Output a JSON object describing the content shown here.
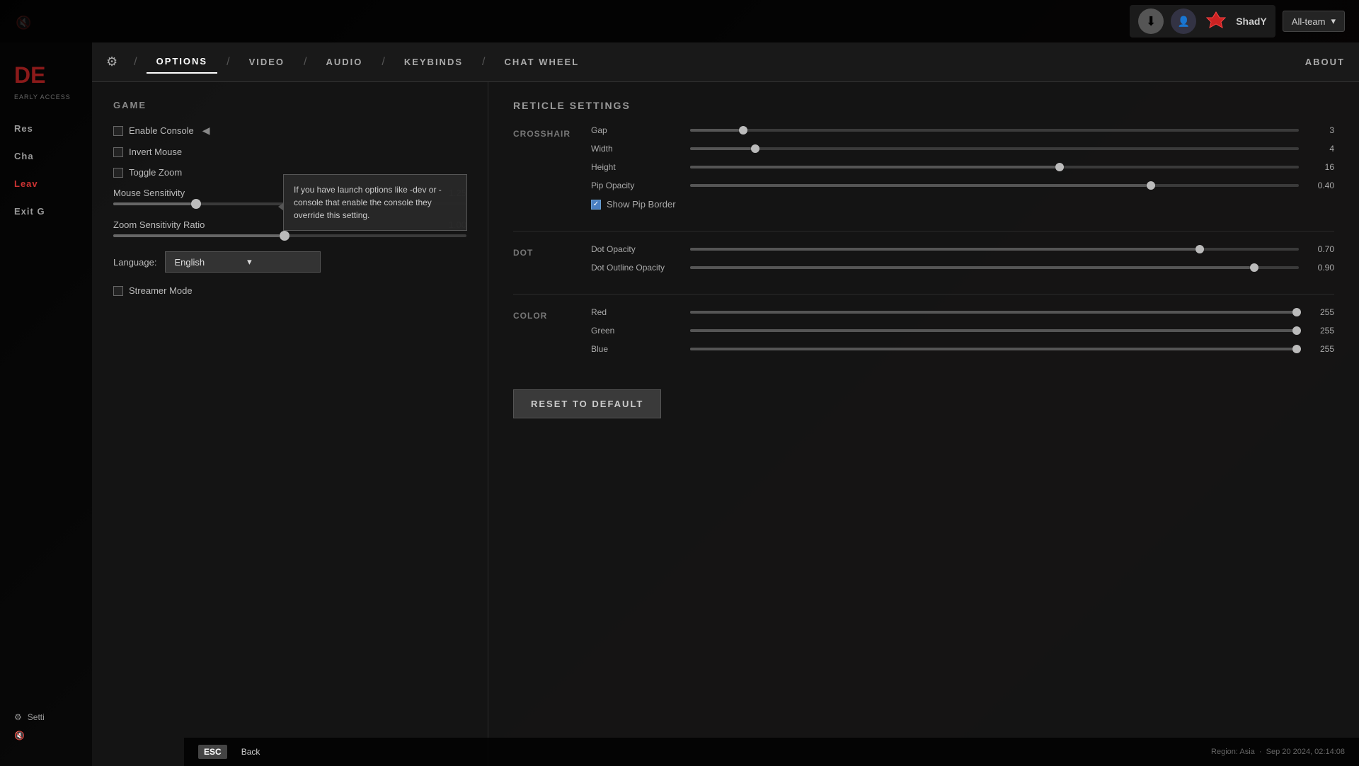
{
  "app": {
    "volume_icon": "🔇"
  },
  "topbar": {
    "download_icon": "⬇",
    "user_avatar_icon": "👤",
    "user_badge_color": "#cc2222",
    "username": "ShadY",
    "team_selector_label": "All-team",
    "chevron_down": "▾"
  },
  "sidebar": {
    "logo_text": "DE",
    "subtitle": "EARLY ACCESS",
    "items": [
      {
        "label": "Res",
        "active": false,
        "red": false
      },
      {
        "label": "Cha",
        "active": false,
        "red": false
      },
      {
        "label": "Leav",
        "active": false,
        "red": true
      },
      {
        "label": "Exit G",
        "active": false,
        "red": false
      }
    ],
    "settings_label": "Setti",
    "settings_icon": "⚙",
    "volume_icon": "🔇"
  },
  "navbar": {
    "gear_icon": "⚙",
    "options_label": "OPTIONS",
    "video_label": "VIDEO",
    "audio_label": "AUDIO",
    "keybinds_label": "KEYBINDS",
    "chat_wheel_label": "CHAT WHEEL",
    "about_label": "ABOUT",
    "sep": "/"
  },
  "game_section": {
    "title": "GAME",
    "enable_console": {
      "label": "Enable Console",
      "checked": false
    },
    "invert_mouse": {
      "label": "Invert Mouse",
      "checked": false
    },
    "toggle_zoom": {
      "label": "Toggle Zoom",
      "checked": false
    },
    "tooltip": "If you have launch options like -dev or -console that enable the console they override this setting.",
    "mouse_sensitivity": {
      "label": "Mouse Sensitivity",
      "value": "1.25",
      "percent": 22
    },
    "zoom_sensitivity": {
      "label": "Zoom Sensitivity Ratio",
      "value": "1.00",
      "percent": 47
    },
    "language": {
      "label": "Language:",
      "value": "English"
    },
    "streamer_mode": {
      "label": "Streamer Mode",
      "checked": false
    }
  },
  "reticle_section": {
    "title": "RETICLE SETTINGS",
    "crosshair": {
      "label": "CROSSHAIR",
      "gap": {
        "label": "Gap",
        "value": "3",
        "percent": 8
      },
      "width": {
        "label": "Width",
        "value": "4",
        "percent": 10
      },
      "height": {
        "label": "Height",
        "value": "16",
        "percent": 60
      },
      "pip_opacity": {
        "label": "Pip Opacity",
        "value": "0.40",
        "percent": 75
      },
      "show_pip_border": {
        "label": "Show Pip Border",
        "checked": true
      }
    },
    "dot": {
      "label": "DOT",
      "dot_opacity": {
        "label": "Dot Opacity",
        "value": "0.70",
        "percent": 83
      },
      "dot_outline_opacity": {
        "label": "Dot Outline Opacity",
        "value": "0.90",
        "percent": 92
      }
    },
    "color": {
      "label": "COLOR",
      "red": {
        "label": "Red",
        "value": "255",
        "percent": 100
      },
      "green": {
        "label": "Green",
        "value": "255",
        "percent": 100
      },
      "blue": {
        "label": "Blue",
        "value": "255",
        "percent": 100
      }
    }
  },
  "buttons": {
    "reset_to_default": "RESET TO DEFAULT",
    "esc": "ESC",
    "back": "Back"
  },
  "status": {
    "region": "Region: Asia",
    "datetime": "Sep 20 2024, 02:14:08"
  }
}
